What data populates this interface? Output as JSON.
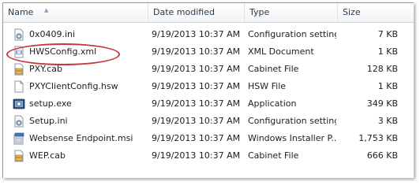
{
  "columns": {
    "name": "Name",
    "date": "Date modified",
    "type": "Type",
    "size": "Size"
  },
  "files": [
    {
      "name": "0x0409.ini",
      "date": "9/19/2013 10:37 AM",
      "type": "Configuration settings",
      "size": "7 KB",
      "icon": "ini-settings-icon"
    },
    {
      "name": "HWSConfig.xml",
      "date": "9/19/2013 10:37 AM",
      "type": "XML Document",
      "size": "1 KB",
      "icon": "xml-document-icon"
    },
    {
      "name": "PXY.cab",
      "date": "9/19/2013 10:37 AM",
      "type": "Cabinet File",
      "size": "128 KB",
      "icon": "cabinet-file-icon"
    },
    {
      "name": "PXYClientConfig.hsw",
      "date": "9/19/2013 10:37 AM",
      "type": "HSW File",
      "size": "1 KB",
      "icon": "blank-file-icon"
    },
    {
      "name": "setup.exe",
      "date": "9/19/2013 10:37 AM",
      "type": "Application",
      "size": "349 KB",
      "icon": "setup-exe-icon"
    },
    {
      "name": "Setup.ini",
      "date": "9/19/2013 10:37 AM",
      "type": "Configuration settings",
      "size": "3 KB",
      "icon": "ini-settings-icon"
    },
    {
      "name": "Websense Endpoint.msi",
      "date": "9/19/2013 10:37 AM",
      "type": "Windows Installer P...",
      "size": "1,753 KB",
      "icon": "msi-installer-icon"
    },
    {
      "name": "WEP.cab",
      "date": "9/19/2013 10:37 AM",
      "type": "Cabinet File",
      "size": "666 KB",
      "icon": "cabinet-file-icon"
    }
  ],
  "colors": {
    "highlight": "#c8353b"
  }
}
